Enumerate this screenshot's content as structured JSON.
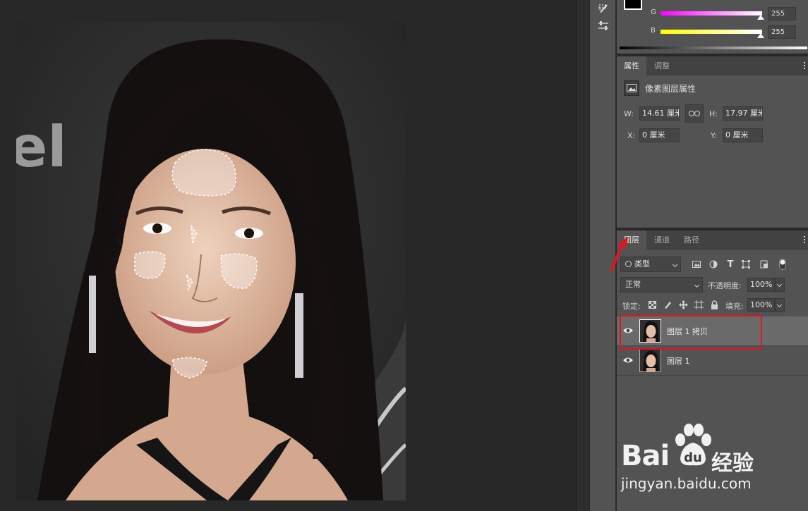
{
  "color_panel": {
    "channels": [
      {
        "label": "G",
        "value": "255",
        "gradient": "linear-gradient(to right,#ff00ff,#ffffff)"
      },
      {
        "label": "B",
        "value": "255",
        "gradient": "linear-gradient(to right,#ffff00,#ffffff)"
      }
    ]
  },
  "properties": {
    "tabs": [
      "属性",
      "调整"
    ],
    "active_tab": "属性",
    "header": "像素图层属性",
    "w_label": "W:",
    "w_value": "14.61 厘米",
    "h_label": "H:",
    "h_value": "17.97 厘米",
    "x_label": "X:",
    "x_value": "0 厘米",
    "y_label": "Y:",
    "y_value": "0 厘米"
  },
  "layers": {
    "tabs": [
      "图层",
      "通道",
      "路径"
    ],
    "active_tab": "图层",
    "filter_kind": "类型",
    "blend_mode": "正常",
    "opacity_label": "不透明度:",
    "opacity_value": "100%",
    "lock_label": "锁定:",
    "fill_label": "填充:",
    "fill_value": "100%",
    "items": [
      {
        "name": "图层 1 拷贝",
        "selected": true,
        "visible": true
      },
      {
        "name": "图层 1",
        "selected": false,
        "visible": true
      }
    ]
  },
  "watermark": {
    "brand": "Bai",
    "brand_cn": "经验",
    "url": "jingyan.baidu.com"
  },
  "colors": {
    "annotation_red": "#e3141b",
    "panel_bg": "#535353",
    "canvas_bg": "#282828"
  }
}
